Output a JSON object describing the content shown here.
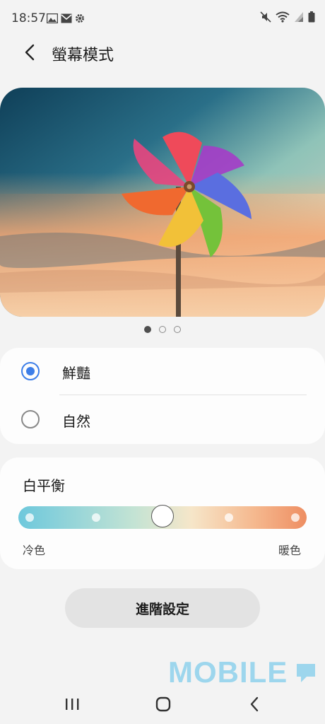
{
  "status_bar": {
    "time": "18:57",
    "left_icons": [
      "image-icon",
      "mail-icon",
      "gear-icon"
    ],
    "right_icons": [
      "mute-icon",
      "wifi-icon",
      "signal-icon",
      "battery-icon"
    ]
  },
  "header": {
    "title": "螢幕模式",
    "back_icon": "chevron-left-icon"
  },
  "preview": {
    "image": "pinwheel-photo",
    "pager": {
      "count": 3,
      "active": 1
    }
  },
  "mode_options": [
    {
      "label": "鮮豔",
      "selected": true
    },
    {
      "label": "自然",
      "selected": false
    }
  ],
  "white_balance": {
    "title": "白平衡",
    "cool_label": "冷色",
    "warm_label": "暖色",
    "steps": 5,
    "current_step": 3,
    "colors": [
      "#6dc8dc",
      "#f6e6c9",
      "#ee8e62"
    ]
  },
  "advanced_button": "進階設定",
  "watermark": "MOBILE",
  "nav_bar": [
    "recents-icon",
    "home-icon",
    "back-icon"
  ],
  "colors": {
    "accent": "#3d7ee8",
    "background": "#f3f3f3",
    "card": "#fdfdfd"
  }
}
